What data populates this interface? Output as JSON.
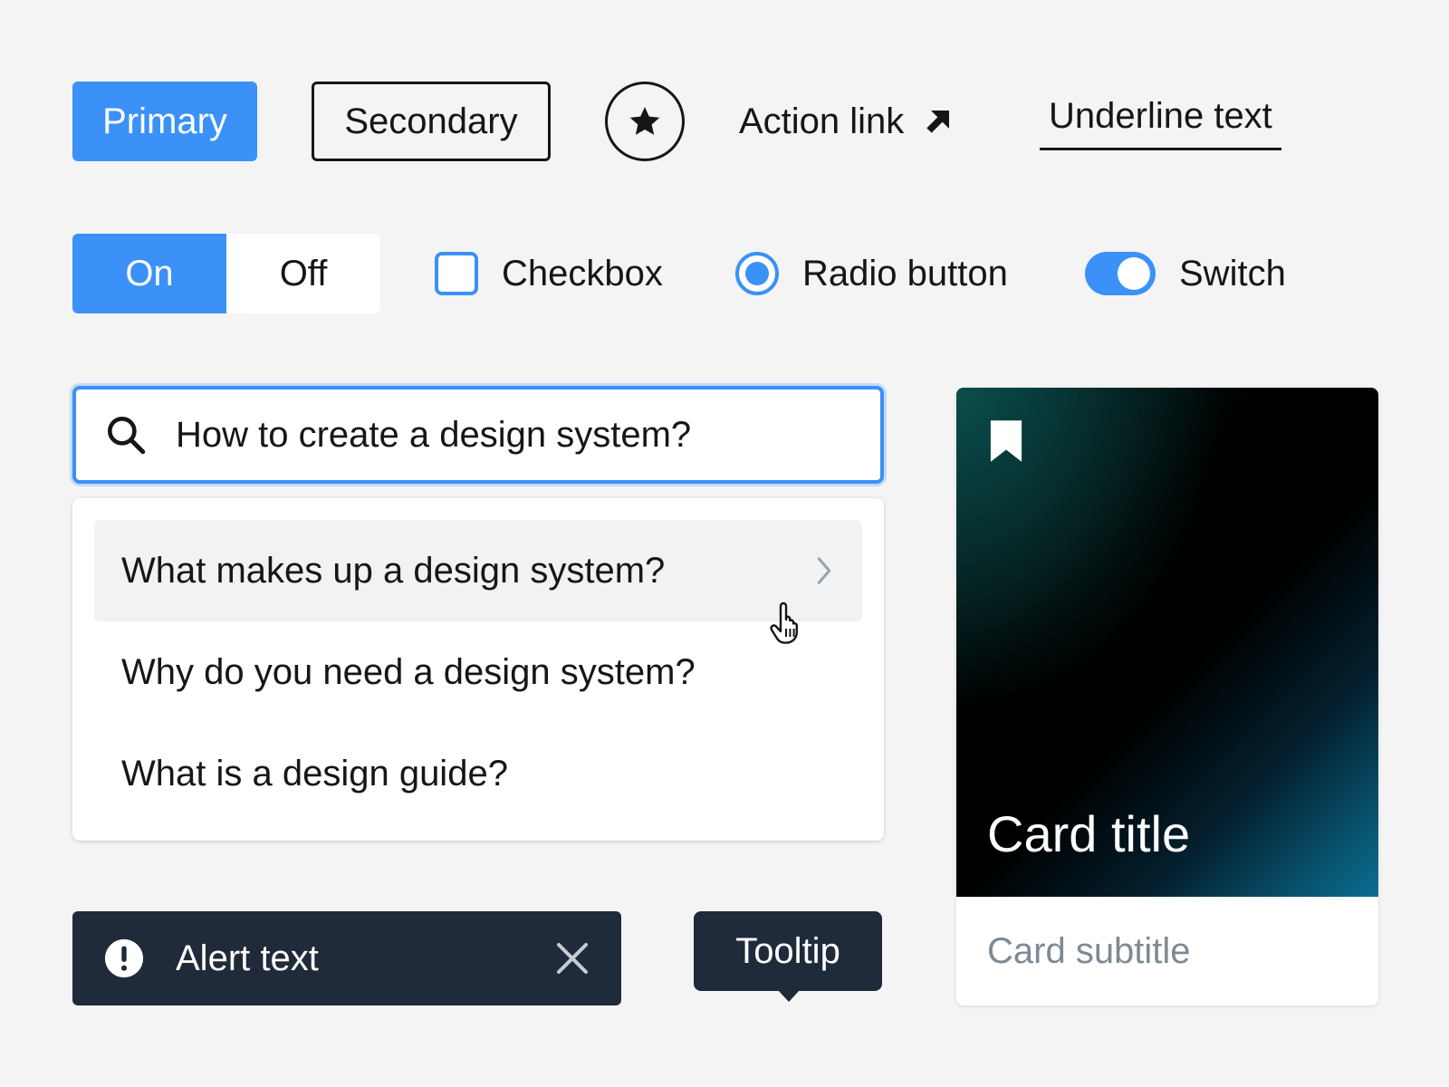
{
  "buttons": {
    "primary_label": "Primary",
    "secondary_label": "Secondary",
    "icon_button_icon": "star-icon",
    "action_link_label": "Action link",
    "action_link_icon": "arrow-up-right-icon",
    "underline_label": "Underline text"
  },
  "toggle": {
    "on_label": "On",
    "off_label": "Off",
    "selected": "On"
  },
  "checkbox": {
    "label": "Checkbox",
    "checked": false
  },
  "radio": {
    "label": "Radio button",
    "selected": true
  },
  "switch": {
    "label": "Switch",
    "on": true
  },
  "search": {
    "value": "How to create a design system?",
    "icon": "search-icon"
  },
  "suggestions": [
    {
      "label": "What makes up a design system?"
    },
    {
      "label": "Why do you need a design system?"
    },
    {
      "label": "What is a design guide?"
    }
  ],
  "card": {
    "title": "Card title",
    "subtitle": "Card subtitle",
    "icon": "bookmark-icon"
  },
  "alert": {
    "text": "Alert text",
    "icon": "exclamation-icon",
    "close_icon": "close-icon"
  },
  "tooltip": {
    "text": "Tooltip"
  },
  "colors": {
    "accent": "#3b91f7",
    "text": "#161616",
    "background": "#f4f4f4",
    "dark_surface": "#1f2a3a",
    "muted": "#7d8a96"
  }
}
